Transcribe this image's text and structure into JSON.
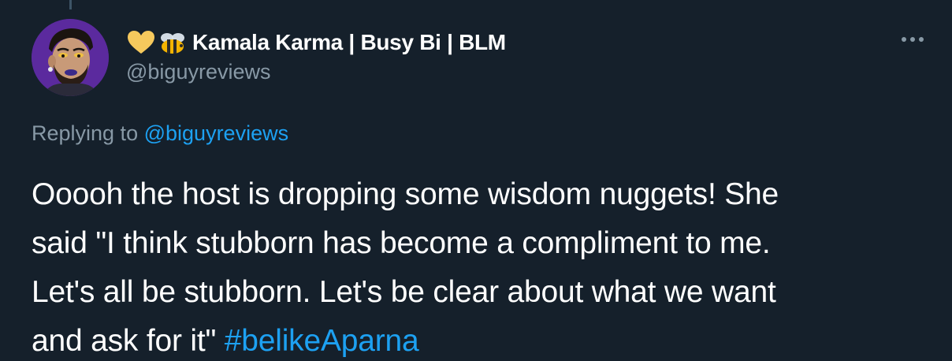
{
  "tweet": {
    "author": {
      "emojis": [
        "yellow-heart",
        "bee"
      ],
      "display_name": "Kamala Karma | Busy Bi | BLM",
      "handle": "@biguyreviews"
    },
    "reply": {
      "prefix": "Replying to",
      "mention": "@biguyreviews"
    },
    "text_lines": [
      "Ooooh the host is dropping some wisdom nuggets! She",
      "said \"I think stubborn has become a compliment to me.",
      "Let's all be stubborn. Let's be clear about what we want",
      "and ask for it\""
    ],
    "hashtag": "#belikeAparna"
  },
  "colors": {
    "background": "#15202b",
    "text": "#ffffff",
    "secondary_text": "#8899a6",
    "link": "#1da1f2",
    "avatar_bg": "#5b2a9e"
  }
}
